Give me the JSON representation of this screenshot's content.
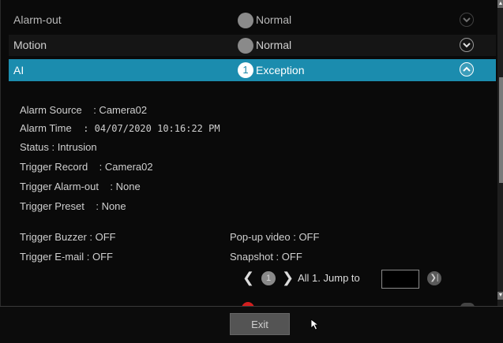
{
  "rows": [
    {
      "name": "Alarm-out",
      "status": "Normal"
    },
    {
      "name": "Motion",
      "status": "Normal"
    },
    {
      "name": "AI",
      "badge": "1",
      "status": "Exception"
    }
  ],
  "detail": {
    "alarm_source_label": "Alarm Source",
    "alarm_source_value": ": Camera02",
    "alarm_time_label": "Alarm Time",
    "alarm_time_value": ": 04/07/2020 10:16:22 PM",
    "status": "Status : Intrusion",
    "trigger_record_label": "Trigger Record",
    "trigger_record_value": ": Camera02",
    "trigger_alarm_out_label": "Trigger Alarm-out",
    "trigger_alarm_out_value": ": None",
    "trigger_preset_label": "Trigger Preset",
    "trigger_preset_value": ": None",
    "trigger_buzzer": "Trigger Buzzer : OFF",
    "trigger_email": "Trigger E-mail : OFF",
    "popup_video": "Pop-up video : OFF",
    "snapshot": "Snapshot : OFF"
  },
  "pager": {
    "prev": "❮",
    "page": "1",
    "next": "❯",
    "summary": "All 1. Jump to",
    "jump_value": "",
    "go": "❯|"
  },
  "footer": {
    "exit_label": "Exit"
  },
  "icons": {
    "expand": "chevron-down-icon",
    "collapse": "chevron-up-icon"
  },
  "colors": {
    "selected_row": "#1b8cae",
    "normal_dot": "#8a8a8a",
    "exception_badge": "#ffffff"
  }
}
